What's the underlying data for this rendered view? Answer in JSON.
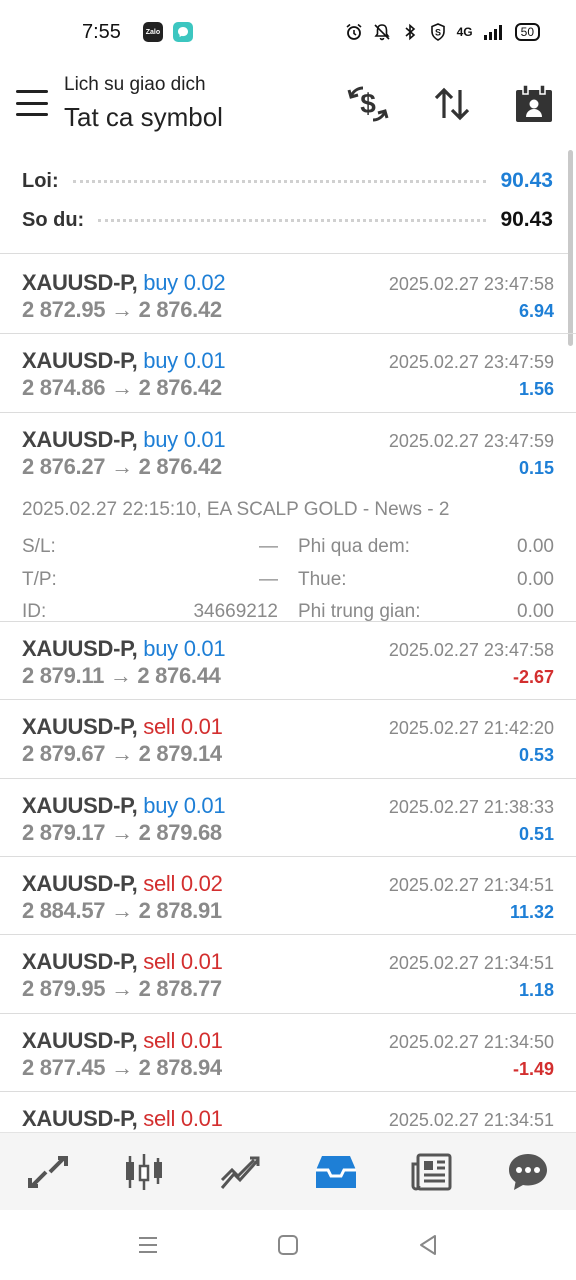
{
  "status_bar": {
    "time": "7:55",
    "app_icons": [
      "Zalo",
      "messenger"
    ],
    "network": "4G",
    "battery": "50"
  },
  "header": {
    "subtitle": "Lich su giao dich",
    "title": "Tat ca symbol",
    "actions": [
      "dollar-swap-icon",
      "sort-icon",
      "calendar-icon"
    ]
  },
  "summary": {
    "profit_label": "Loi:",
    "profit_value": "90.43",
    "balance_label": "So du:",
    "balance_value": "90.43",
    "profit_color": "#1e7fd6"
  },
  "arrow": "→",
  "trades": [
    {
      "symbol": "XAUUSD-P,",
      "type": "buy",
      "volume": "0.02",
      "time": "2025.02.27 23:47:58",
      "open": "2 872.95",
      "close": "2 876.42",
      "profit": "6.94",
      "positive": true
    },
    {
      "symbol": "XAUUSD-P,",
      "type": "buy",
      "volume": "0.01",
      "time": "2025.02.27 23:47:59",
      "open": "2 874.86",
      "close": "2 876.42",
      "profit": "1.56",
      "positive": true
    },
    {
      "symbol": "XAUUSD-P,",
      "type": "buy",
      "volume": "0.01",
      "time": "2025.02.27 23:47:59",
      "open": "2 876.27",
      "close": "2 876.42",
      "profit": "0.15",
      "positive": true,
      "details": {
        "header": "2025.02.27 22:15:10, EA SCALP GOLD - News - 2",
        "sl_label": "S/L:",
        "sl_value": "—",
        "tp_label": "T/P:",
        "tp_value": "—",
        "id_label": "ID:",
        "id_value": "34669212",
        "swap_label": "Phi qua dem:",
        "swap_value": "0.00",
        "tax_label": "Thue:",
        "tax_value": "0.00",
        "commission_label": "Phi trung gian:",
        "commission_value": "0.00"
      }
    },
    {
      "symbol": "XAUUSD-P,",
      "type": "buy",
      "volume": "0.01",
      "time": "2025.02.27 23:47:58",
      "open": "2 879.11",
      "close": "2 876.44",
      "profit": "-2.67",
      "positive": false
    },
    {
      "symbol": "XAUUSD-P,",
      "type": "sell",
      "volume": "0.01",
      "time": "2025.02.27 21:42:20",
      "open": "2 879.67",
      "close": "2 879.14",
      "profit": "0.53",
      "positive": true
    },
    {
      "symbol": "XAUUSD-P,",
      "type": "buy",
      "volume": "0.01",
      "time": "2025.02.27 21:38:33",
      "open": "2 879.17",
      "close": "2 879.68",
      "profit": "0.51",
      "positive": true
    },
    {
      "symbol": "XAUUSD-P,",
      "type": "sell",
      "volume": "0.02",
      "time": "2025.02.27 21:34:51",
      "open": "2 884.57",
      "close": "2 878.91",
      "profit": "11.32",
      "positive": true
    },
    {
      "symbol": "XAUUSD-P,",
      "type": "sell",
      "volume": "0.01",
      "time": "2025.02.27 21:34:51",
      "open": "2 879.95",
      "close": "2 878.77",
      "profit": "1.18",
      "positive": true
    },
    {
      "symbol": "XAUUSD-P,",
      "type": "sell",
      "volume": "0.01",
      "time": "2025.02.27 21:34:50",
      "open": "2 877.45",
      "close": "2 878.94",
      "profit": "-1.49",
      "positive": false
    },
    {
      "symbol": "XAUUSD-P,",
      "type": "sell",
      "volume": "0.01",
      "time": "2025.02.27 21:34:51",
      "open": "",
      "close": "",
      "profit": "",
      "positive": true
    }
  ],
  "bottom_nav": [
    {
      "icon": "quotes-icon",
      "active": false
    },
    {
      "icon": "chart-icon",
      "active": false
    },
    {
      "icon": "trade-icon",
      "active": false
    },
    {
      "icon": "history-icon",
      "active": true
    },
    {
      "icon": "news-icon",
      "active": false
    },
    {
      "icon": "chat-icon",
      "active": false
    }
  ],
  "colors": {
    "buy": "#1e7fd6",
    "sell": "#d32f2f",
    "active_nav": "#1e7fd6"
  }
}
